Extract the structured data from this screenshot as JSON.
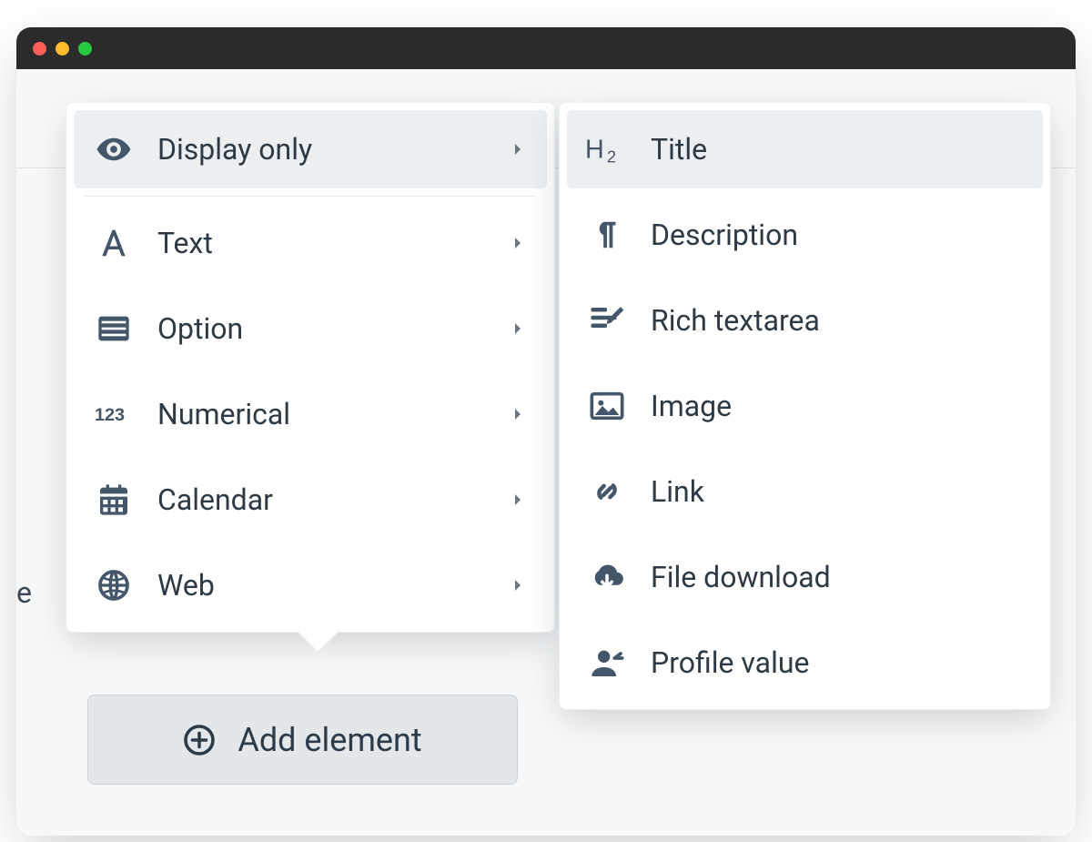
{
  "menu_left": {
    "selected_index": 0,
    "items": [
      {
        "label": "Display only",
        "icon": "eye-icon",
        "has_submenu": true,
        "has_separator_below": true
      },
      {
        "label": "Text",
        "icon": "letter-a-icon",
        "has_submenu": true
      },
      {
        "label": "Option",
        "icon": "list-icon",
        "has_submenu": true
      },
      {
        "label": "Numerical",
        "icon": "numbers-icon",
        "has_submenu": true
      },
      {
        "label": "Calendar",
        "icon": "calendar-icon",
        "has_submenu": true
      },
      {
        "label": "Web",
        "icon": "globe-icon",
        "has_submenu": true
      }
    ]
  },
  "menu_right": {
    "selected_index": 0,
    "items": [
      {
        "label": "Title",
        "icon": "heading-h2-icon"
      },
      {
        "label": "Description",
        "icon": "pilcrow-icon"
      },
      {
        "label": "Rich textarea",
        "icon": "rich-text-icon"
      },
      {
        "label": "Image",
        "icon": "image-icon"
      },
      {
        "label": "Link",
        "icon": "link-icon"
      },
      {
        "label": "File download",
        "icon": "download-cloud-icon"
      },
      {
        "label": "Profile value",
        "icon": "profile-icon"
      }
    ]
  },
  "button": {
    "add_element_label": "Add element"
  },
  "bg": {
    "stray_text": "e"
  },
  "colors": {
    "icon": "#44566a",
    "text": "#2d3a45",
    "selected_bg": "#eceff1"
  }
}
